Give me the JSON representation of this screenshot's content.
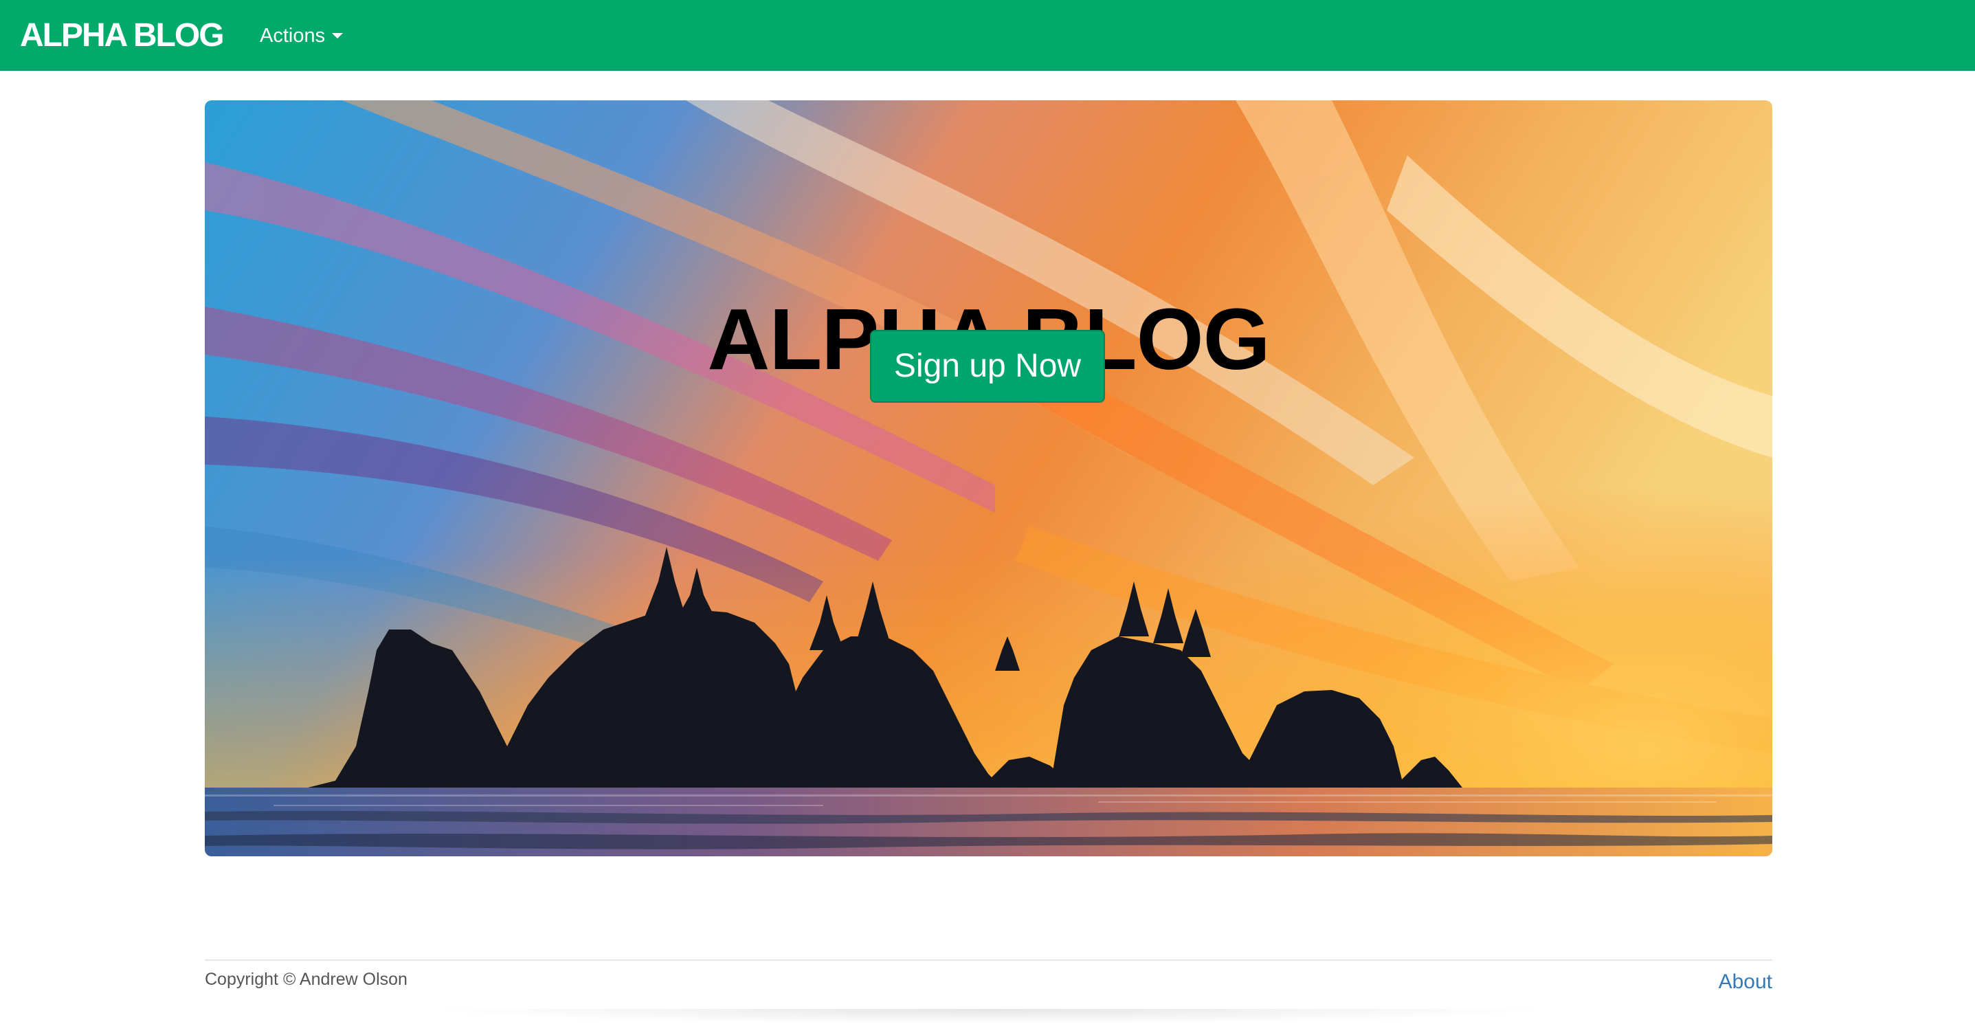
{
  "navbar": {
    "brand": "ALPHA BLOG",
    "actions_label": "Actions",
    "background_color": "#01a96b",
    "caret_icon": "chevron-down-icon"
  },
  "hero": {
    "title": "ALPHA BLOG",
    "signup_label": "Sign up Now",
    "background_image": "sunset-sea-stacks-landscape",
    "button_color": "#00a56e"
  },
  "footer": {
    "copyright": "Copyright © Andrew Olson",
    "about_label": "About",
    "link_color": "#337ab7"
  }
}
